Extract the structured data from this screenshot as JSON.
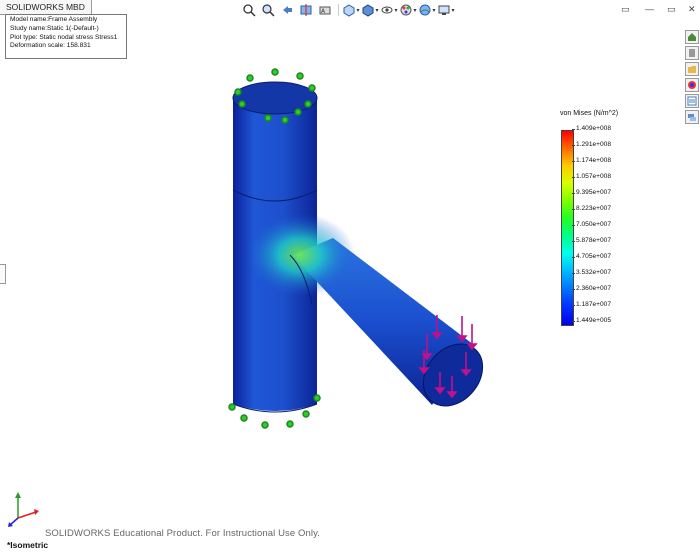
{
  "window": {
    "tab_label": "SOLIDWORKS MBD"
  },
  "info": {
    "model_name": "Model name:Frame Assembly",
    "study_name": "Study name:Static 1(-Default-)",
    "plot_type": "Plot type: Static nodal stress Stress1",
    "deformation_scale": "Deformation scale: 158.831"
  },
  "toolbar": {
    "icons": [
      "zoom-to-fit-icon",
      "zoom-area-icon",
      "previous-view-icon",
      "section-view-icon",
      "dynamic-annotation-icon",
      "view-orientation-icon",
      "display-style-icon",
      "hide-show-icon",
      "edit-appearance-icon",
      "apply-scene-icon",
      "view-settings-icon"
    ]
  },
  "legend": {
    "title": "von Mises (N/m^2)",
    "ticks": [
      "1.409e+008",
      "1.291e+008",
      "1.174e+008",
      "1.057e+008",
      "9.395e+007",
      "8.223e+007",
      "7.050e+007",
      "5.878e+007",
      "4.705e+007",
      "3.532e+007",
      "2.360e+007",
      "1.187e+007",
      "1.449e+005"
    ],
    "colors": {
      "max": "#ff0000",
      "min": "#0000ee"
    }
  },
  "task_pane": {
    "icons": [
      "home-icon",
      "parts-library-icon",
      "file-explorer-icon",
      "appearances-icon",
      "custom-properties-icon",
      "forum-icon"
    ]
  },
  "footer": {
    "watermark": "SOLIDWORKS Educational Product. For Instructional Use Only.",
    "view_label": "*Isometric"
  },
  "triad": {
    "x": "X",
    "y": "Y",
    "z": "Z"
  }
}
